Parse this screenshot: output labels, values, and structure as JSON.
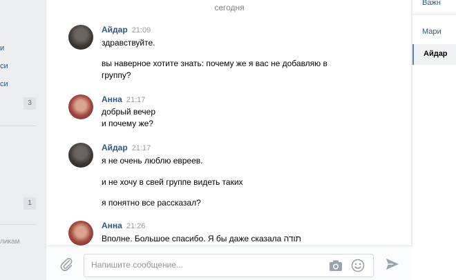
{
  "left_nav": {
    "items": [
      {
        "label": "и"
      },
      {
        "label": "си"
      },
      {
        "label": "си"
      }
    ],
    "badges": [
      "3",
      "1"
    ],
    "footer": "ликам"
  },
  "chat": {
    "date_separator": "сегодня",
    "messages": [
      {
        "author": "Айдар",
        "time": "21:09",
        "lines": [
          "здравствуйте.",
          "вы наверное хотите знать: почему же я вас не добавляю в",
          "группу?"
        ]
      },
      {
        "author": "Анна",
        "time": "21:17",
        "lines": [
          "добрый вечер",
          "и почему же?"
        ]
      },
      {
        "author": "Айдар",
        "time": "21:17",
        "lines": [
          "я не очень люблю евреев.",
          "и не хочу в свей группе видеть таких",
          "я понятно все рассказал?"
        ]
      },
      {
        "author": "Анна",
        "time": "21:26",
        "lines": [
          "Вполне. Большое спасибо. Я бы даже сказала תודה"
        ]
      }
    ],
    "composer": {
      "placeholder": "Напишите сообщение..."
    }
  },
  "right_panel": {
    "items": [
      {
        "label": "Важн"
      },
      {
        "label": "Мари"
      }
    ],
    "active_item": "Айдар"
  },
  "colors": {
    "link": "#2a5885",
    "accent": "#5181b8",
    "background": "#edeef0"
  }
}
